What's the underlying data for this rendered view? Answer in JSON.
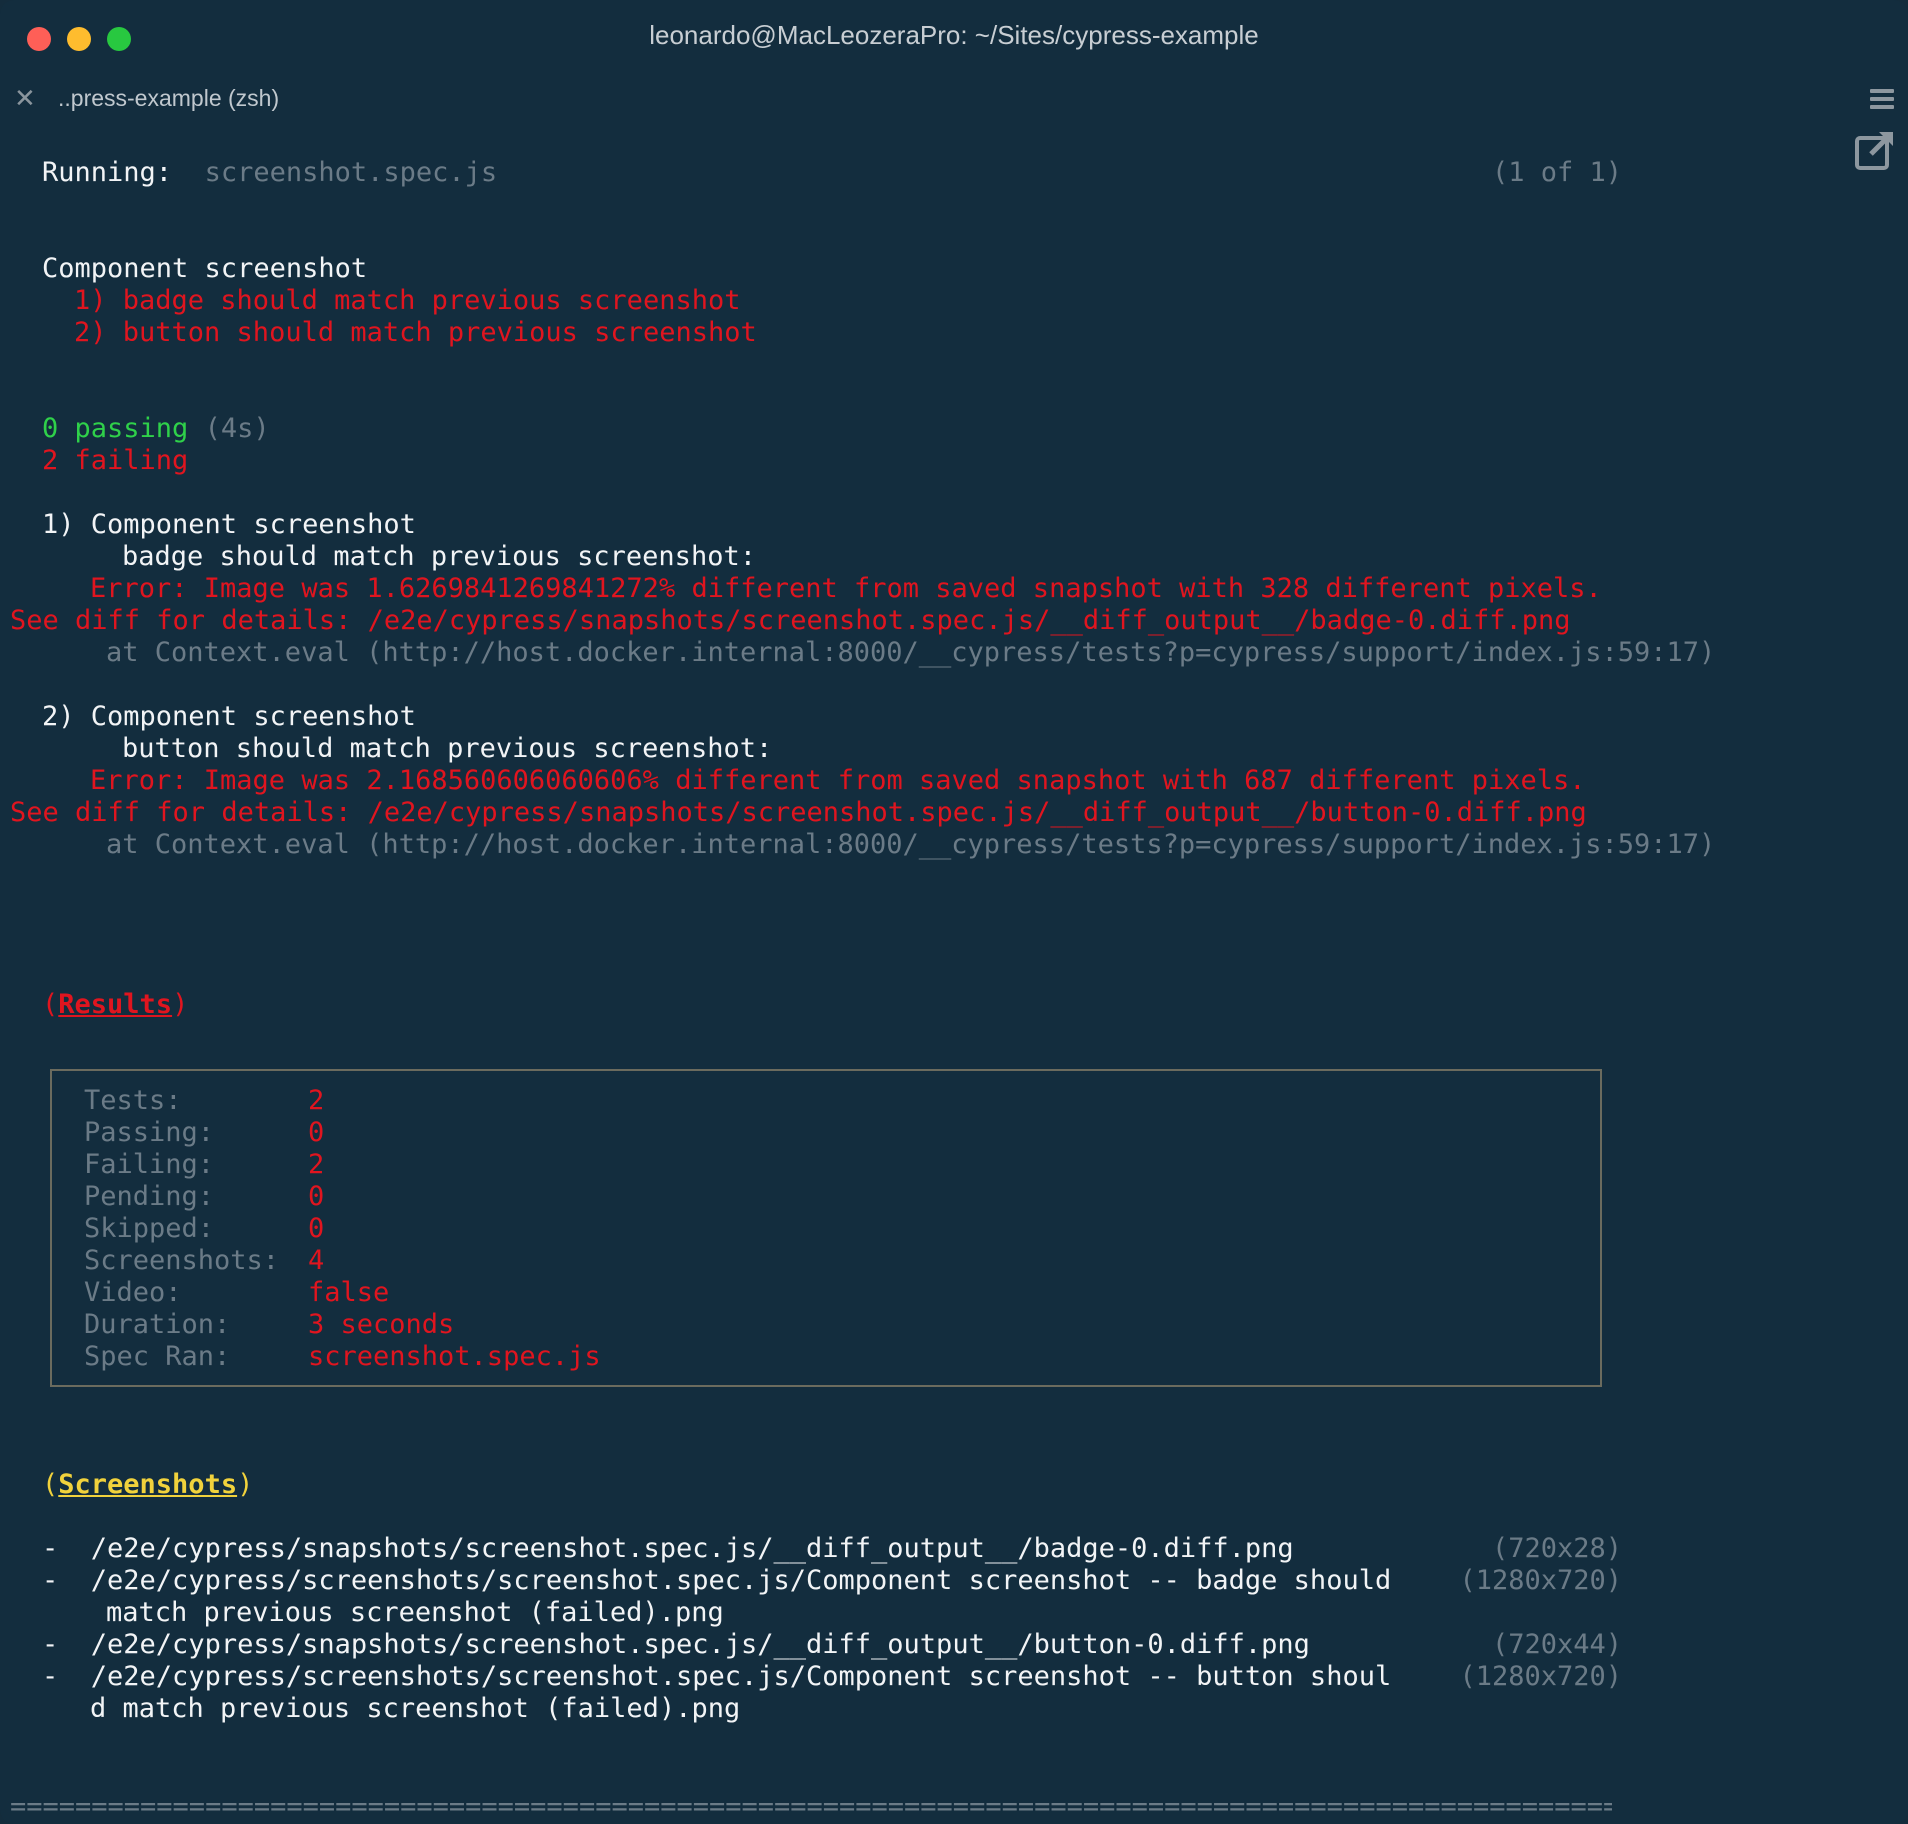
{
  "window": {
    "title": "leonardo@MacLeozeraPro: ~/Sites/cypress-example",
    "tab_label": "..press-example (zsh)"
  },
  "run": {
    "label": "Running:",
    "spec": "screenshot.spec.js",
    "count": "(1 of 1)"
  },
  "suite": {
    "name": "Component screenshot",
    "tests": [
      "1) badge should match previous screenshot",
      "2) button should match previous screenshot"
    ]
  },
  "summary": {
    "passing": "0 passing",
    "time": "(4s)",
    "failing": "2 failing"
  },
  "failures": [
    {
      "header": "1) Component screenshot",
      "title": "badge should match previous screenshot:",
      "error": "Error: Image was 1.6269841269841272% different from saved snapshot with 328 different pixels.",
      "diff": "See diff for details: /e2e/cypress/snapshots/screenshot.spec.js/__diff_output__/badge-0.diff.png",
      "stack": "at Context.eval (http://host.docker.internal:8000/__cypress/tests?p=cypress/support/index.js:59:17)"
    },
    {
      "header": "2) Component screenshot",
      "title": "button should match previous screenshot:",
      "error": "Error: Image was 2.168560606060606% different from saved snapshot with 687 different pixels.",
      "diff": "See diff for details: /e2e/cypress/snapshots/screenshot.spec.js/__diff_output__/button-0.diff.png",
      "stack": "at Context.eval (http://host.docker.internal:8000/__cypress/tests?p=cypress/support/index.js:59:17)"
    }
  ],
  "results": {
    "heading": "Results",
    "rows": [
      {
        "key": "Tests:",
        "value": "2"
      },
      {
        "key": "Passing:",
        "value": "0"
      },
      {
        "key": "Failing:",
        "value": "2"
      },
      {
        "key": "Pending:",
        "value": "0"
      },
      {
        "key": "Skipped:",
        "value": "0"
      },
      {
        "key": "Screenshots:",
        "value": "4"
      },
      {
        "key": "Video:",
        "value": "false"
      },
      {
        "key": "Duration:",
        "value": "3 seconds"
      },
      {
        "key": "Spec Ran:",
        "value": "screenshot.spec.js"
      }
    ]
  },
  "screenshots": {
    "heading": "Screenshots",
    "items": [
      {
        "path": "/e2e/cypress/snapshots/screenshot.spec.js/__diff_output__/badge-0.diff.png",
        "cont": "",
        "size": "(720x28)"
      },
      {
        "path": "/e2e/cypress/screenshots/screenshot.spec.js/Component screenshot -- badge should",
        "cont": "match previous screenshot (failed).png",
        "size": "(1280x720)"
      },
      {
        "path": "/e2e/cypress/snapshots/screenshot.spec.js/__diff_output__/button-0.diff.png",
        "cont": "",
        "size": "(720x44)"
      },
      {
        "path": "/e2e/cypress/screenshots/screenshot.spec.js/Component screenshot -- button shoul",
        "cont": "d match previous screenshot (failed).png",
        "size": "(1280x720)"
      }
    ]
  },
  "footer_rule": "===================================================================================================="
}
